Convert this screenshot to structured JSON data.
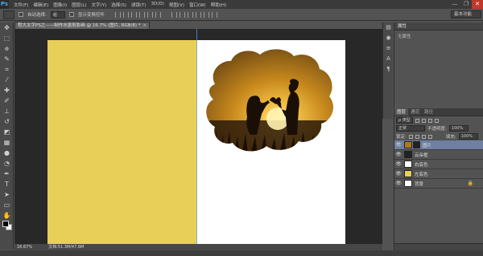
{
  "app": {
    "logo": "Ps"
  },
  "menu": [
    "文件(F)",
    "编辑(E)",
    "图像(I)",
    "图层(L)",
    "文字(Y)",
    "选择(S)",
    "滤镜(T)",
    "3D(D)",
    "视图(V)",
    "窗口(W)",
    "帮助(H)"
  ],
  "window_controls": {
    "minimize": "—",
    "restore": "❐",
    "close": "✕"
  },
  "options": {
    "auto_select_label": "自动选择:",
    "auto_select_value": "组",
    "show_transform_label": "显示变换控件",
    "workspace": "基本功能"
  },
  "document": {
    "tab_title": "程大太字PS之——制作水墨剪影画 @ 16.7% (图片, RGB/8) *",
    "tab_close": "×",
    "zoom": "16.67%",
    "doc_info": "文档:51.3M/47.6M"
  },
  "canvas": {
    "left_color": "#e8cf57",
    "right_color": "#ffffff"
  },
  "tools": [
    "move-icon",
    "marquee-icon",
    "lasso-icon",
    "quick-select-icon",
    "crop-icon",
    "eyedropper-icon",
    "healing-icon",
    "brush-icon",
    "stamp-icon",
    "history-brush-icon",
    "eraser-icon",
    "gradient-icon",
    "blur-icon",
    "dodge-icon",
    "pen-icon",
    "type-icon",
    "path-select-icon",
    "shape-icon",
    "hand-icon",
    "zoom-icon"
  ],
  "properties": {
    "title": "属性",
    "empty_text": "无属性"
  },
  "layers": {
    "tabs": [
      "图层",
      "通道",
      "路径"
    ],
    "filter_label": "ρ 类型",
    "blend_mode": "正常",
    "opacity_label": "不透明度:",
    "opacity_value": "100%",
    "lock_label": "锁定:",
    "fill_label": "填充:",
    "fill_value": "100%",
    "items": [
      {
        "name": "图片",
        "thumb": "#b07a22",
        "selected": true,
        "has_mask": true
      },
      {
        "name": "云朵框",
        "thumb": "#222222",
        "selected": false,
        "has_mask": false
      },
      {
        "name": "右底色",
        "thumb": "#ffffff",
        "selected": false,
        "has_mask": false
      },
      {
        "name": "左底色",
        "thumb": "#e8cf57",
        "selected": false,
        "has_mask": false
      },
      {
        "name": "背景",
        "thumb": "#ffffff",
        "selected": false,
        "has_mask": false,
        "locked": true
      }
    ]
  }
}
